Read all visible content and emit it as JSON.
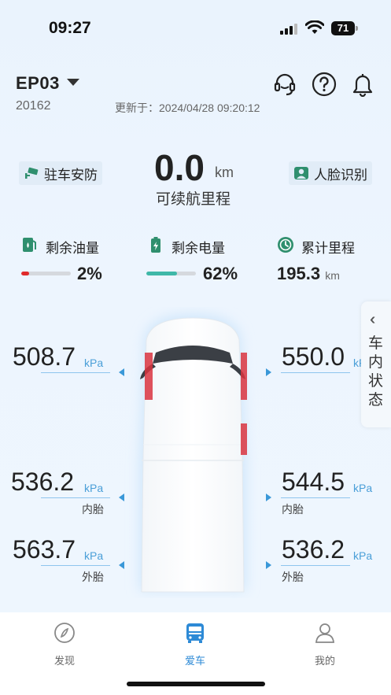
{
  "status_bar": {
    "time": "09:27",
    "battery": "71"
  },
  "header": {
    "vehicle_name": "EP03",
    "vehicle_code": "20162",
    "updated": "更新于：2024/04/28 09:20:12",
    "icons": [
      "headset-icon",
      "help-icon",
      "bell-icon"
    ]
  },
  "main": {
    "parking_security": "驻车安防",
    "face_recognition": "人脸识别",
    "range_value": "0.0",
    "range_unit": "km",
    "range_label": "可续航里程"
  },
  "stats": {
    "fuel": {
      "label": "剩余油量",
      "value": "2%",
      "fraction": 0.02,
      "color": "#e02b2b"
    },
    "battery": {
      "label": "剩余电量",
      "value": "62%",
      "fraction": 0.62,
      "color": "#3fb8a8"
    },
    "mileage": {
      "label": "累计里程",
      "value": "195.3",
      "unit": "km"
    }
  },
  "side_tab": {
    "label": "车内状态"
  },
  "tires": {
    "front_left": {
      "value": "508.7",
      "unit": "kPa"
    },
    "front_right": {
      "value": "550.0",
      "unit": "kPa"
    },
    "rear_left_inner": {
      "value": "536.2",
      "unit": "kPa",
      "tag": "内胎"
    },
    "rear_right_inner": {
      "value": "544.5",
      "unit": "kPa",
      "tag": "内胎"
    },
    "rear_left_outer": {
      "value": "563.7",
      "unit": "kPa",
      "tag": "外胎"
    },
    "rear_right_outer": {
      "value": "536.2",
      "unit": "kPa",
      "tag": "外胎"
    }
  },
  "tabbar": {
    "items": [
      {
        "label": "发现",
        "icon": "discover-icon",
        "active": false
      },
      {
        "label": "爱车",
        "icon": "car-icon",
        "active": true
      },
      {
        "label": "我的",
        "icon": "profile-icon",
        "active": false
      }
    ]
  },
  "colors": {
    "accent": "#2d8ad6",
    "tire_line": "#8ec5ee",
    "alert_red": "#d9343f"
  }
}
